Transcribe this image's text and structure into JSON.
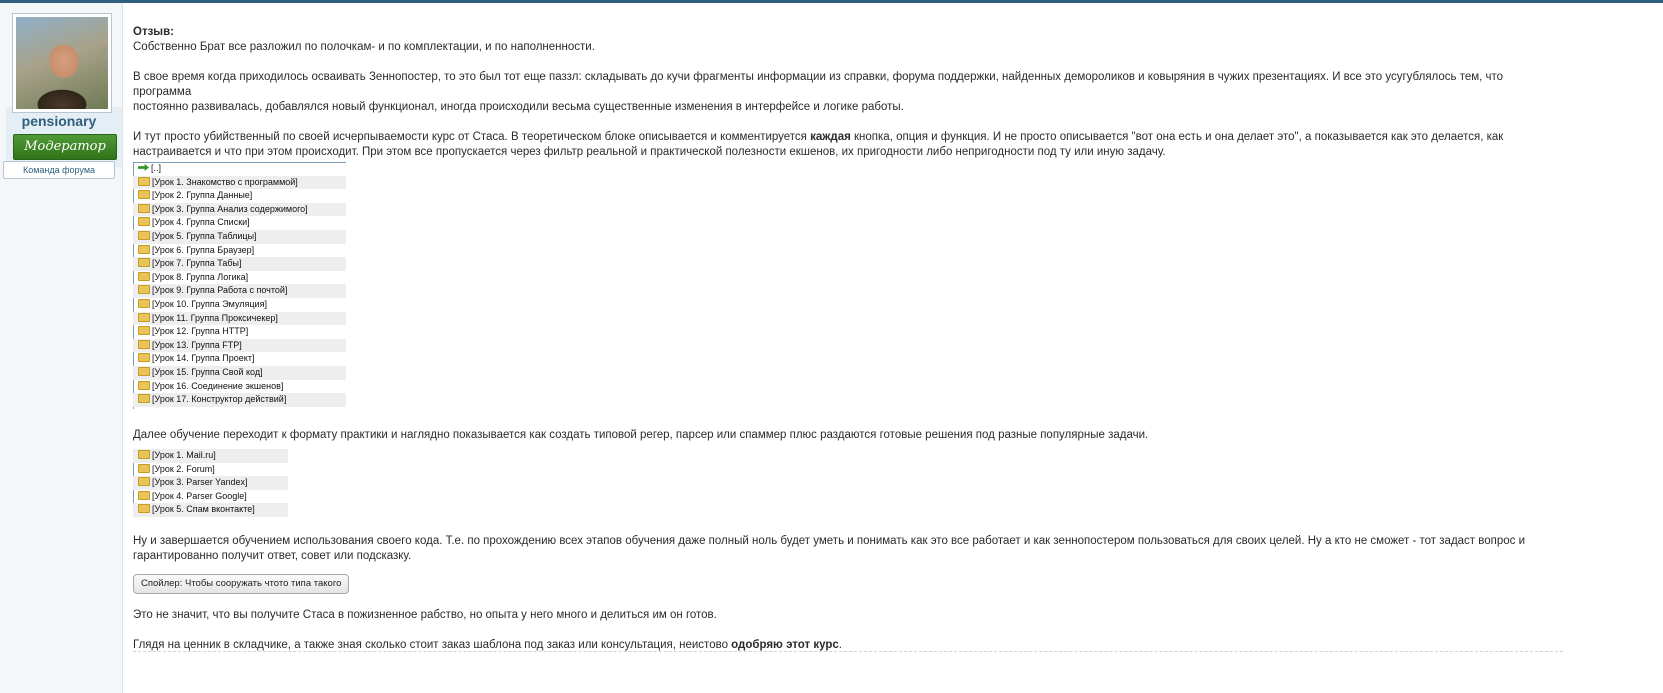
{
  "user": {
    "username": "pensionary",
    "rank": "Модератор",
    "team": "Команда форума"
  },
  "post": {
    "heading": "Отзыв:",
    "p1": "Собственно Брат все разложил по полочкам- и по комплектации, и по наполненности.",
    "p2": "В свое время когда приходилось осваивать Зеннопостер, то это был тот еще паззл: складывать до кучи фрагменты информации из справки, форума поддержки, найденных демороликов и ковыряния в чужих презентациях. И все это усугублялось тем, что программа",
    "p2b": "постоянно развивалась, добавлялся новый функционал, иногда происходили весьма существенные изменения в интерфейсе и логике работы.",
    "p3a": "И тут просто убийственный по своей исчерпываемости курс от Стаса. В теоретическом блоке описывается и комментируется ",
    "p3bold": "каждая",
    "p3b": " кнопка, опция и функция. И не просто описывается \"вот она есть и она делает это\", а показывается как это делается, как",
    "p3c": "настраивается и что при этом происходит. При этом все пропускается через фильтр реальной и практической полезности екшенов, их пригодности либо непригодности под ту или иную задачу.",
    "tree1_up": "[..]",
    "tree1": [
      "[Урок 1. Знакомство с программой]",
      "[Урок 2. Группа Данные]",
      "[Урок 3. Группа Анализ содержимого]",
      "[Урок 4. Группа Списки]",
      "[Урок 5. Группа Таблицы]",
      "[Урок 6. Группа Браузер]",
      "[Урок 7. Группа Табы]",
      "[Урок 8. Группа Логика]",
      "[Урок 9. Группа Работа с почтой]",
      "[Урок 10. Группа Эмуляция]",
      "[Урок 11. Группа Проксичекер]",
      "[Урок 12. Группа HTTP]",
      "[Урок 13. Группа FTP]",
      "[Урок 14. Группа Проект]",
      "[Урок 15. Группа Свой код]",
      "[Урок 16. Соединение экшенов]",
      "[Урок 17. Конструктор действий]"
    ],
    "p4": "Далее обучение переходит к формату практики и наглядно показывается как создать типовой регер, парсер или спаммер плюс раздаются готовые решения под разные популярные задачи.",
    "tree2": [
      "[Урок 1. Mail.ru]",
      "[Урок 2. Forum]",
      "[Урок 3. Parser Yandex]",
      "[Урок 4. Parser Google]",
      "[Урок 5. Спам вконтакте]"
    ],
    "p5": "Ну и завершается обучением использования своего кода. Т.е. по прохождению всех этапов обучения даже полный ноль будет уметь и понимать как это все работает и как зеннопостером пользоваться для своих целей. Ну а кто не сможет - тот задаст вопрос и",
    "p5b": "гарантированно получит ответ, совет или подсказку.",
    "spoiler_label": "Спойлер: Чтобы сооружать чтото типа такого",
    "p6": "Это не значит, что вы получите Стаса в пожизненное рабство, но опыта у него много и делиться им он готов.",
    "p7a": "Глядя на ценник в складчике, а также зная сколько стоит заказ шаблона под заказ или консультация, неистово ",
    "p7bold": "одобряю этот курс",
    "p7end": "."
  }
}
